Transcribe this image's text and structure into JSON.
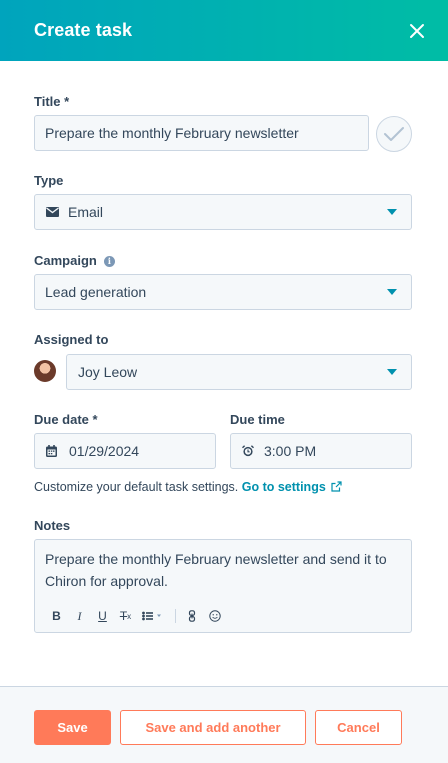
{
  "header": {
    "title": "Create task",
    "close_icon": "close-icon"
  },
  "title_field": {
    "label": "Title *",
    "value": "Prepare the monthly February newsletter"
  },
  "type_field": {
    "label": "Type",
    "value": "Email",
    "icon": "envelope-icon"
  },
  "campaign_field": {
    "label": "Campaign",
    "value": "Lead generation",
    "info_icon": "i"
  },
  "assigned_field": {
    "label": "Assigned to",
    "value": "Joy Leow"
  },
  "due_date": {
    "label": "Due date *",
    "value": "01/29/2024",
    "icon": "calendar-icon"
  },
  "due_time": {
    "label": "Due time",
    "value": "3:00 PM",
    "icon": "alarm-clock-icon"
  },
  "hint": {
    "text": "Customize your default task settings.",
    "link": "Go to settings"
  },
  "notes": {
    "label": "Notes",
    "value": "Prepare the monthly February newsletter and send it to Chiron for approval.",
    "toolbar": {
      "bold": "B",
      "italic": "I",
      "underline": "U",
      "clear_format": "T"
    }
  },
  "footer": {
    "save": "Save",
    "save_add_another": "Save and add another",
    "cancel": "Cancel"
  },
  "colors": {
    "header_gradient_start": "#00a4bd",
    "header_gradient_end": "#00bda5",
    "accent_orange": "#ff7a59",
    "link_teal": "#0091ae",
    "field_bg": "#f5f8fa",
    "border": "#cbd6e2",
    "text": "#33475b"
  }
}
